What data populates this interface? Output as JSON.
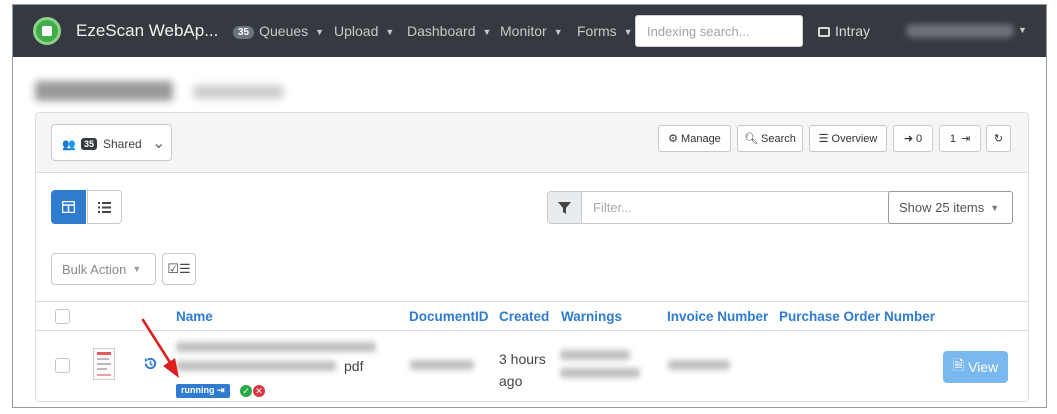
{
  "navbar": {
    "brand": "EzeScan WebAp...",
    "queues_count": "35",
    "items": [
      {
        "label": "Queues"
      },
      {
        "label": "Upload"
      },
      {
        "label": "Dashboard"
      },
      {
        "label": "Monitor"
      },
      {
        "label": "Forms"
      }
    ],
    "search_placeholder": "Indexing search...",
    "intray_label": "Intray"
  },
  "toolbar": {
    "shared_count": "35",
    "shared_label": "Shared",
    "manage_label": "Manage",
    "search_label": "Search",
    "overview_label": "Overview",
    "in_count": "0",
    "out_count": "1"
  },
  "controls": {
    "filter_placeholder": "Filter...",
    "show_items_label": "Show 25 items",
    "bulk_action_label": "Bulk Action"
  },
  "table": {
    "headers": {
      "name": "Name",
      "document_id": "DocumentID",
      "created": "Created",
      "warnings": "Warnings",
      "invoice_number": "Invoice Number",
      "purchase_order_number": "Purchase Order Number"
    },
    "rows": [
      {
        "name_suffix": "pdf",
        "status_badge": "running",
        "created": "3 hours ago",
        "action_label": "View"
      }
    ]
  },
  "colors": {
    "navbar_bg": "#343a40",
    "primary": "#2f7bd0",
    "view_button": "#7ab8f0",
    "annotation_arrow": "#e02020"
  }
}
